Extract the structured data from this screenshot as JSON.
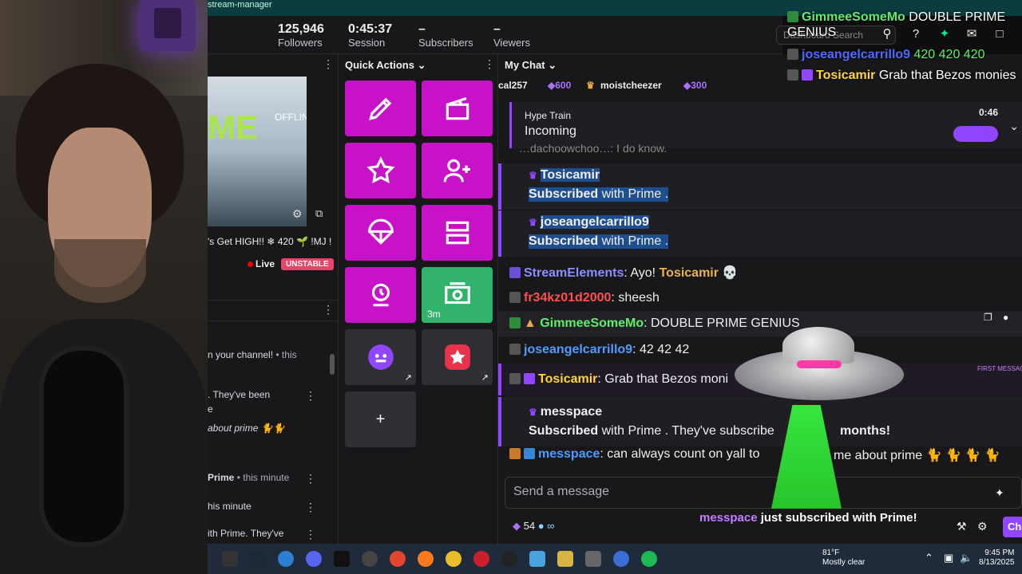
{
  "window": {
    "title": "stream-manager"
  },
  "stats": [
    {
      "value": "125,946",
      "label": "Followers"
    },
    {
      "value": "0:45:37",
      "label": "Session"
    },
    {
      "value": "–",
      "label": "Subscribers"
    },
    {
      "value": "–",
      "label": "Viewers"
    }
  ],
  "search": {
    "placeholder": "Dashboard Search"
  },
  "preview": {
    "status": "OFFLINE",
    "graphic_text": "ME"
  },
  "stream_info": {
    "title": "'s Get HIGH!! ❄ 420 🌱 !MJ !",
    "live_label": "Live",
    "unstable_label": "UNSTABLE"
  },
  "activity": [
    {
      "text": "n your channel!",
      "extra": " • this"
    },
    {
      "text": ". They've been"
    },
    {
      "text": "e"
    },
    {
      "text": "about prime"
    },
    {
      "text": "Prime",
      "extra": " • this minute"
    },
    {
      "text": "his minute"
    },
    {
      "text": "ith Prime. They've"
    }
  ],
  "quick_actions": {
    "header": "Quick Actions",
    "buttons": [
      {
        "name": "edit-stream-info",
        "icon": "pencil-icon"
      },
      {
        "name": "clip",
        "icon": "clapperboard-icon"
      },
      {
        "name": "run-ad",
        "icon": "star-icon"
      },
      {
        "name": "raid",
        "icon": "add-user-icon"
      },
      {
        "name": "drops",
        "icon": "parachute-icon"
      },
      {
        "name": "layout",
        "icon": "layout-icon"
      },
      {
        "name": "rewards",
        "icon": "reward-icon"
      },
      {
        "name": "ad-timer",
        "icon": "cash-icon",
        "sub": "3m"
      },
      {
        "name": "ext-bot",
        "icon": "bot-icon"
      },
      {
        "name": "ext-star",
        "icon": "star-badge-icon"
      }
    ],
    "add_label": "+"
  },
  "chat": {
    "header": "My Chat",
    "leaders": [
      {
        "name": "cal257",
        "bits": "600"
      },
      {
        "name": "moistcheezer",
        "bits": "300"
      }
    ],
    "hype": {
      "label": "Hype Train",
      "status": "Incoming",
      "timer": "0:46"
    },
    "partial_top": "…dachoowchoo…: I do know.",
    "subs": [
      {
        "name": "Tosicamir",
        "line_bold": "Subscribed",
        "line_rest": " with Prime ."
      },
      {
        "name": "joseangelcarrillo9",
        "line_bold": "Subscribed",
        "line_rest": " with Prime ."
      }
    ],
    "messages": [
      {
        "user": "StreamElements",
        "color": "#8d8dff",
        "text": ": Ayo! ",
        "mention": "Tosicamir",
        "tail": " 💀"
      },
      {
        "user": "fr34kz01d2000",
        "color": "#ff4f4f",
        "text": ": sheesh"
      },
      {
        "user": "GimmeeSomeMo",
        "color": "#5cf06a",
        "text": ": DOUBLE PRIME GENIUS"
      },
      {
        "user": "joseangelcarrillo9",
        "color": "#4f9bff",
        "text": ": 42 42 42"
      },
      {
        "user": "Tosicamir",
        "color": "#ffd633",
        "text": ": Grab that Bezos moni"
      }
    ],
    "first_msg": "FIRST MESSAGE",
    "sub3": {
      "name": "messpace",
      "line_bold": "Subscribed",
      "line_rest": " with Prime . They've subscribe",
      "tail": "months!"
    },
    "last_msg": {
      "user": "messpace",
      "text": ": can always count on yall to ",
      "tail": "me about prime"
    },
    "input_placeholder": "Send a message",
    "points": "54",
    "chat_button": "Cha"
  },
  "overlay": {
    "alert_name": "messpace",
    "alert_text": " just subscribed with Prime!",
    "chat": [
      {
        "user": "GimmeeSomeMo",
        "text": " DOUBLE PRIME GENIUS"
      },
      {
        "user": "joseangelcarrillo9",
        "text": " 420 420 420"
      },
      {
        "user": "Tosicamir",
        "text": " Grab that Bezos monies"
      }
    ]
  },
  "taskbar": {
    "weather_temp": "81°F",
    "weather_desc": "Mostly clear",
    "time": "9:45 PM",
    "date": "8/13/2025"
  },
  "colors": {
    "accent": "#9147ff",
    "quick_action": "#c712c8",
    "green": "#31b36c"
  }
}
